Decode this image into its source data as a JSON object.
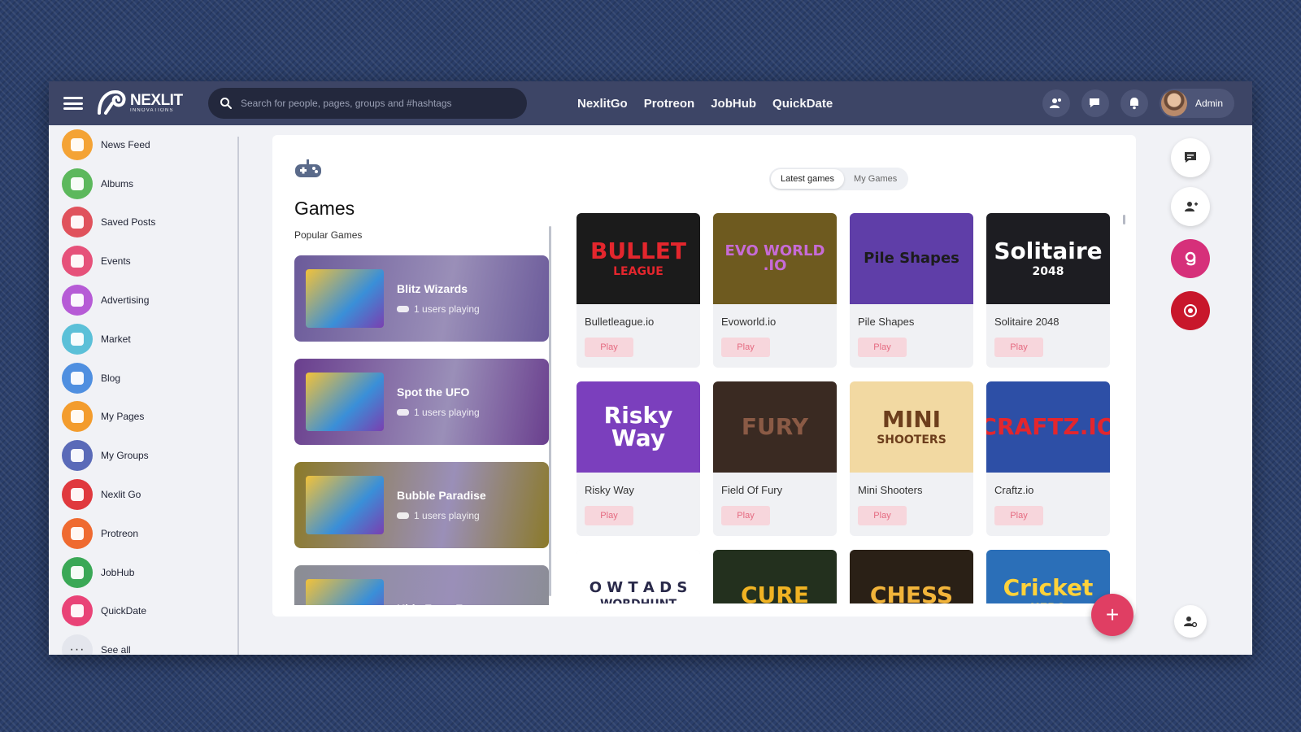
{
  "header": {
    "logo_text": "NEXLIT",
    "logo_sub": "INNOVATIONS",
    "search_placeholder": "Search for people, pages, groups and #hashtags",
    "nav": [
      "NexlitGo",
      "Protreon",
      "JobHub",
      "QuickDate"
    ],
    "user_name": "Admin"
  },
  "sidebar": {
    "items": [
      {
        "label": "News Feed",
        "icon": "home-icon",
        "color": "#f4a335"
      },
      {
        "label": "Albums",
        "icon": "albums-icon",
        "color": "#5cb85c"
      },
      {
        "label": "Saved Posts",
        "icon": "bookmark-icon",
        "color": "#e0525c"
      },
      {
        "label": "Events",
        "icon": "calendar-icon",
        "color": "#e6517a"
      },
      {
        "label": "Advertising",
        "icon": "megaphone-icon",
        "color": "#b65bd6"
      },
      {
        "label": "Market",
        "icon": "bag-icon",
        "color": "#5bc0d8"
      },
      {
        "label": "Blog",
        "icon": "blog-icon",
        "color": "#4f8fe0"
      },
      {
        "label": "My Pages",
        "icon": "flag-icon",
        "color": "#f39c2d"
      },
      {
        "label": "My Groups",
        "icon": "groups-icon",
        "color": "#5a6ab8"
      },
      {
        "label": "Nexlit Go",
        "icon": "play-icon",
        "color": "#e0393e"
      },
      {
        "label": "Protreon",
        "icon": "protreon-icon",
        "color": "#ef6a30"
      },
      {
        "label": "JobHub",
        "icon": "briefcase-icon",
        "color": "#3aa856"
      },
      {
        "label": "QuickDate",
        "icon": "heart-icon",
        "color": "#e94377"
      }
    ],
    "see_all": "See all"
  },
  "main": {
    "title": "Games",
    "popular_title": "Popular Games",
    "tabs": [
      {
        "label": "Latest games",
        "active": true
      },
      {
        "label": "My Games",
        "active": false
      }
    ],
    "popular": [
      {
        "name": "Blitz Wizards",
        "meta": "1 users playing",
        "bg": "#6b5a9a"
      },
      {
        "name": "Spot the UFO",
        "meta": "1 users playing",
        "bg": "#6a3f8e"
      },
      {
        "name": "Bubble Paradise",
        "meta": "1 users playing",
        "bg": "#8b7a2a"
      },
      {
        "name": "Kids Farm Fun",
        "meta": "",
        "bg": "#8a8d93"
      }
    ],
    "games": [
      {
        "name": "Bulletleague.io",
        "play": "Play",
        "thumb_text": "BULLET",
        "thumb_sub": "LEAGUE",
        "bg": "#1b1b1b",
        "fg": "#e3262d"
      },
      {
        "name": "Evoworld.io",
        "play": "Play",
        "thumb_text": "EVO WORLD .IO",
        "thumb_sub": "",
        "bg": "#6e5a1f",
        "fg": "#c76bd6"
      },
      {
        "name": "Pile Shapes",
        "play": "Play",
        "thumb_text": "Pile Shapes",
        "thumb_sub": "",
        "bg": "#5f3ea8",
        "fg": "#1c1c1c"
      },
      {
        "name": "Solitaire 2048",
        "play": "Play",
        "thumb_text": "Solitaire",
        "thumb_sub": "2048",
        "bg": "#1d1d22",
        "fg": "#ffffff"
      },
      {
        "name": "Risky Way",
        "play": "Play",
        "thumb_text": "Risky Way",
        "thumb_sub": "",
        "bg": "#7b3fbd",
        "fg": "#ffffff"
      },
      {
        "name": "Field Of Fury",
        "play": "Play",
        "thumb_text": "FURY",
        "thumb_sub": "",
        "bg": "#3a2a22",
        "fg": "#8a5a45"
      },
      {
        "name": "Mini Shooters",
        "play": "Play",
        "thumb_text": "MINI",
        "thumb_sub": "SHOOTERS",
        "bg": "#f2d9a2",
        "fg": "#6d3e1c"
      },
      {
        "name": "Craftz.io",
        "play": "Play",
        "thumb_text": "CRAFTZ.IO",
        "thumb_sub": "",
        "bg": "#2d4fa6",
        "fg": "#e3262d"
      },
      {
        "name": "",
        "play": "",
        "thumb_text": "O W T A D S",
        "thumb_sub": "WORDHUNT",
        "bg": "#ffffff",
        "fg": "#2a2a4a"
      },
      {
        "name": "",
        "play": "",
        "thumb_text": "CURE",
        "thumb_sub": "",
        "bg": "#23301e",
        "fg": "#f0b323"
      },
      {
        "name": "",
        "play": "",
        "thumb_text": "CHESS",
        "thumb_sub": "",
        "bg": "#2a2016",
        "fg": "#f2b43a"
      },
      {
        "name": "",
        "play": "",
        "thumb_text": "Cricket",
        "thumb_sub": "HERO",
        "bg": "#2b6fb8",
        "fg": "#ffd23a"
      }
    ]
  },
  "colors": {
    "header": "#3d4566",
    "accent": "#e03e63",
    "play_bg": "#f7d6dc",
    "play_text": "#e56a80"
  },
  "fab_label": "+"
}
